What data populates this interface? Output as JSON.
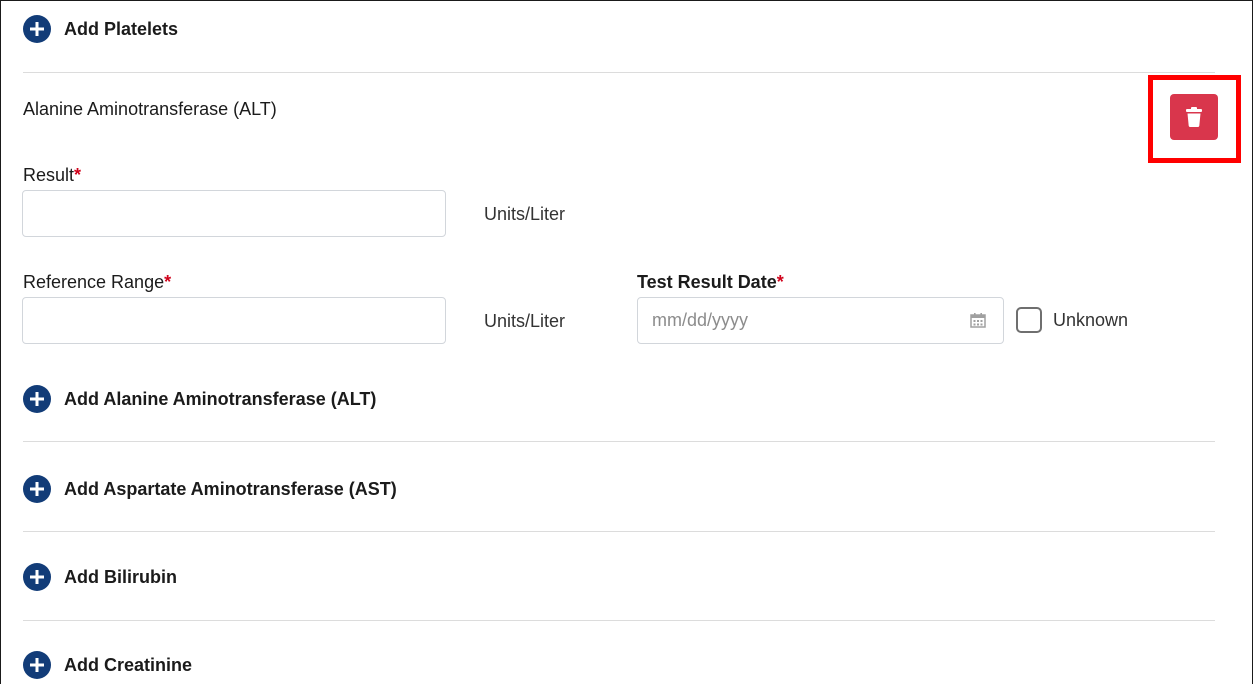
{
  "add_platelets": {
    "label": "Add Platelets",
    "icon": "plus-circle-icon"
  },
  "alt_section": {
    "title": "Alanine Aminotransferase (ALT)",
    "result": {
      "label": "Result",
      "required_mark": "*",
      "value": "",
      "unit": "Units/Liter"
    },
    "reference_range": {
      "label": "Reference Range",
      "required_mark": "*",
      "value": "",
      "unit": "Units/Liter"
    },
    "test_result_date": {
      "label": "Test Result Date",
      "required_mark": "*",
      "placeholder": "mm/dd/yyyy"
    },
    "unknown": {
      "label": "Unknown",
      "checked": false
    },
    "delete_icon": "trash-icon"
  },
  "add_items": [
    {
      "label": "Add Alanine Aminotransferase (ALT)"
    },
    {
      "label": "Add Aspartate Aminotransferase (AST)"
    },
    {
      "label": "Add Bilirubin"
    },
    {
      "label": "Add Creatinine"
    }
  ],
  "colors": {
    "accent_blue": "#123c78",
    "delete_red": "#d9364c",
    "required_red": "#d0021b",
    "highlight_red": "#ff0000"
  }
}
